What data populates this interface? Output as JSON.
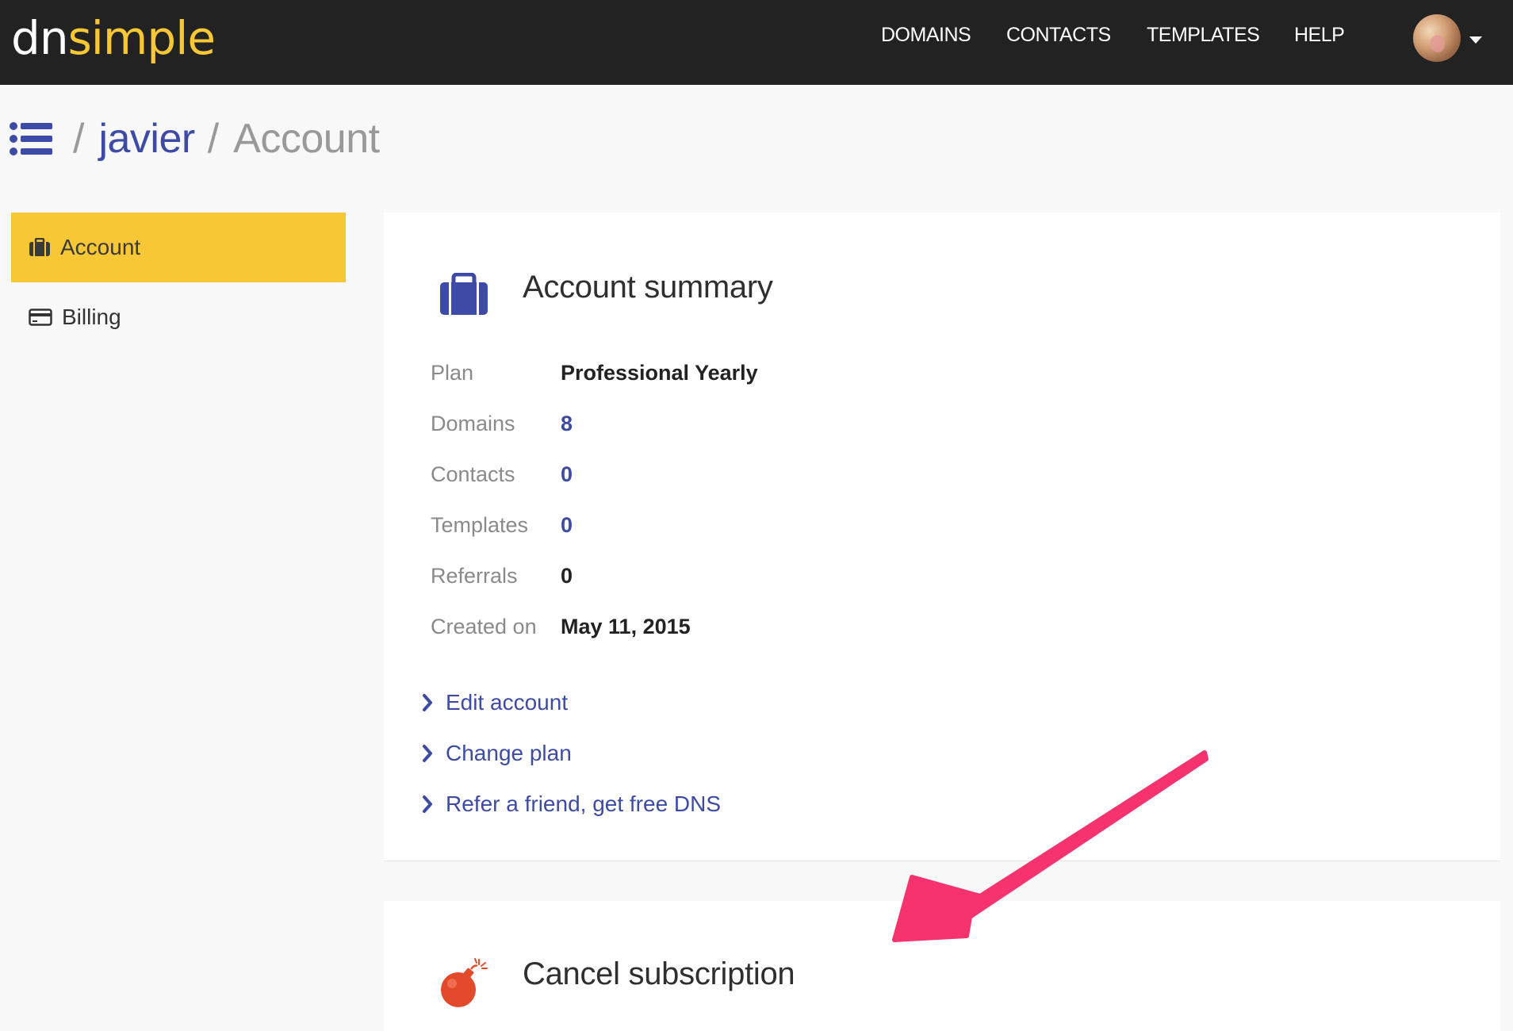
{
  "brand": {
    "logo_part1": "dn",
    "logo_part2": "simple"
  },
  "nav": {
    "items": [
      "DOMAINS",
      "CONTACTS",
      "TEMPLATES",
      "HELP"
    ]
  },
  "breadcrumb": {
    "separator": "/",
    "user": "javier",
    "page": "Account"
  },
  "sidebar": {
    "items": [
      {
        "label": "Account",
        "icon": "briefcase-icon",
        "active": true
      },
      {
        "label": "Billing",
        "icon": "credit-card-icon",
        "active": false
      }
    ]
  },
  "summary": {
    "title": "Account summary",
    "rows": [
      {
        "label": "Plan",
        "value": "Professional Yearly"
      },
      {
        "label": "Domains",
        "value": "8"
      },
      {
        "label": "Contacts",
        "value": "0"
      },
      {
        "label": "Templates",
        "value": "0"
      },
      {
        "label": "Referrals",
        "value": "0"
      },
      {
        "label": "Created on",
        "value": "May 11, 2015"
      }
    ],
    "actions": [
      "Edit account",
      "Change plan",
      "Refer a friend, get free DNS"
    ]
  },
  "cancel": {
    "title": "Cancel subscription"
  },
  "colors": {
    "accent": "#f7c736",
    "link": "#3d4ba6",
    "topbar": "#222222",
    "annotation_arrow": "#f7336f",
    "bomb": "#e34a2c"
  }
}
